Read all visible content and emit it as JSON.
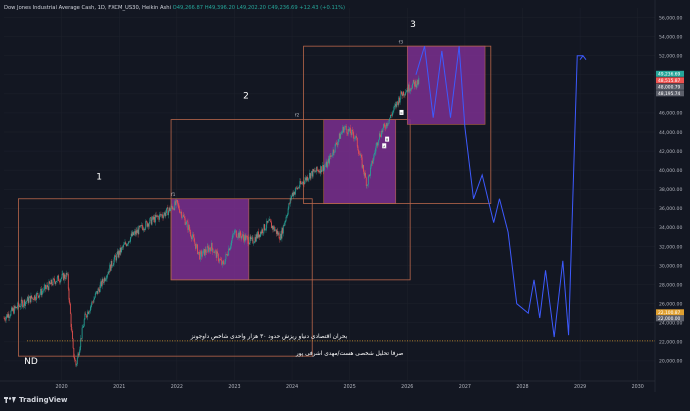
{
  "header": {
    "symbol": "Dow Jones Industrial Average Cash, 1D, FXCM_US30, Heikin Ashi",
    "ohlc": "O49,266.87 H49,396.20 L49,202.20 C49,236.69 +12.43 (+0.11%)"
  },
  "footer": {
    "brand": "TradingView"
  },
  "colors": {
    "background": "#131722",
    "bull": "#26a69a",
    "bear": "#ef5350",
    "box_border": "#b8664a",
    "box_fill": "#7b2f8f",
    "projection": "#3d5afe",
    "dotted_line": "#e0a030"
  },
  "annotations": {
    "wave1": "1",
    "wave2": "2",
    "wave3": "3",
    "f1": "f1",
    "f2": "f2",
    "f3": "f3",
    "nd": "ND",
    "arabic_line1": "بحران اقتصادی دنیاو ریزش حدود ۳۰ هزار واحدی شاخص داوجونز",
    "arabic_line2": "صرفا تحلیل شخصی هست/مهدی اشرفی پور",
    "marker_a": "A",
    "marker_b": "B",
    "marker_c": "C"
  },
  "price_tags": [
    {
      "label": "49,236.69",
      "color": "#26a69a"
    },
    {
      "label": "48,515.87",
      "color": "#ef5350"
    },
    {
      "label": "48,000.79",
      "color": "#5d606b"
    },
    {
      "label": "48,195.74",
      "color": "#5d606b"
    },
    {
      "label": "22,100.87",
      "color": "#e0a030"
    },
    {
      "label": "22,000.00",
      "color": "#5d606b"
    }
  ],
  "chart_data": {
    "type": "line",
    "title": "",
    "x_ticks": [
      "2020",
      "2021",
      "2022",
      "2023",
      "2024",
      "2025",
      "2026",
      "2027",
      "2028",
      "2029",
      "2030"
    ],
    "y_ticks": [
      20000,
      22000,
      24000,
      26000,
      28000,
      30000,
      32000,
      34000,
      36000,
      38000,
      40000,
      42000,
      44000,
      46000,
      48000,
      50000,
      52000,
      54000,
      56000
    ],
    "ylim": [
      18000,
      57000
    ],
    "xlim": [
      2019.0,
      2030.3
    ],
    "price_series": {
      "name": "",
      "x": [
        2019.0,
        2019.3,
        2019.6,
        2019.9,
        2020.1,
        2020.2,
        2020.25,
        2020.4,
        2020.6,
        2020.9,
        2021.2,
        2021.5,
        2021.8,
        2022.0,
        2022.2,
        2022.4,
        2022.6,
        2022.8,
        2023.0,
        2023.3,
        2023.6,
        2023.8,
        2024.0,
        2024.3,
        2024.6,
        2024.9,
        2025.1,
        2025.3,
        2025.5,
        2025.7,
        2025.9,
        2026.1,
        2026.2
      ],
      "y": [
        24500,
        26000,
        27000,
        28500,
        29000,
        21000,
        19500,
        24500,
        27000,
        30500,
        33000,
        34500,
        35500,
        36500,
        34000,
        31000,
        32000,
        30000,
        33500,
        32500,
        34500,
        33000,
        37500,
        39500,
        40500,
        44500,
        43500,
        38500,
        43500,
        45500,
        48000,
        49000,
        49236
      ]
    },
    "projection_series": {
      "name": "",
      "x": [
        2026.15,
        2026.3,
        2026.45,
        2026.6,
        2026.75,
        2026.9,
        2027.0,
        2027.15,
        2027.3,
        2027.5,
        2027.6,
        2027.75,
        2027.9,
        2028.1,
        2028.2,
        2028.3,
        2028.4,
        2028.55,
        2028.7,
        2028.8,
        2028.95,
        2029.05
      ],
      "y": [
        50000,
        53000,
        45500,
        52500,
        45500,
        53000,
        44500,
        37000,
        39500,
        34500,
        37000,
        33500,
        26000,
        25000,
        28500,
        24500,
        29500,
        22500,
        30500,
        22700,
        52000,
        52000
      ]
    },
    "boxes": [
      {
        "label": "big-box-1",
        "x": [
          2019.25,
          2024.35
        ],
        "y": [
          20500,
          37000
        ],
        "fill": false
      },
      {
        "label": "purple-box-1",
        "x": [
          2021.9,
          2023.25
        ],
        "y": [
          28500,
          37000
        ],
        "fill": true
      },
      {
        "label": "big-box-2",
        "x": [
          2021.9,
          2026.05
        ],
        "y": [
          28500,
          45300
        ],
        "fill": false
      },
      {
        "label": "purple-box-2",
        "x": [
          2024.55,
          2025.8
        ],
        "y": [
          36500,
          45300
        ],
        "fill": true
      },
      {
        "label": "big-box-3",
        "x": [
          2024.2,
          2027.45
        ],
        "y": [
          36500,
          53000
        ],
        "fill": false
      },
      {
        "label": "purple-box-3",
        "x": [
          2026.0,
          2027.35
        ],
        "y": [
          44800,
          53000
        ],
        "fill": true
      }
    ],
    "dotted_level": 22100
  }
}
